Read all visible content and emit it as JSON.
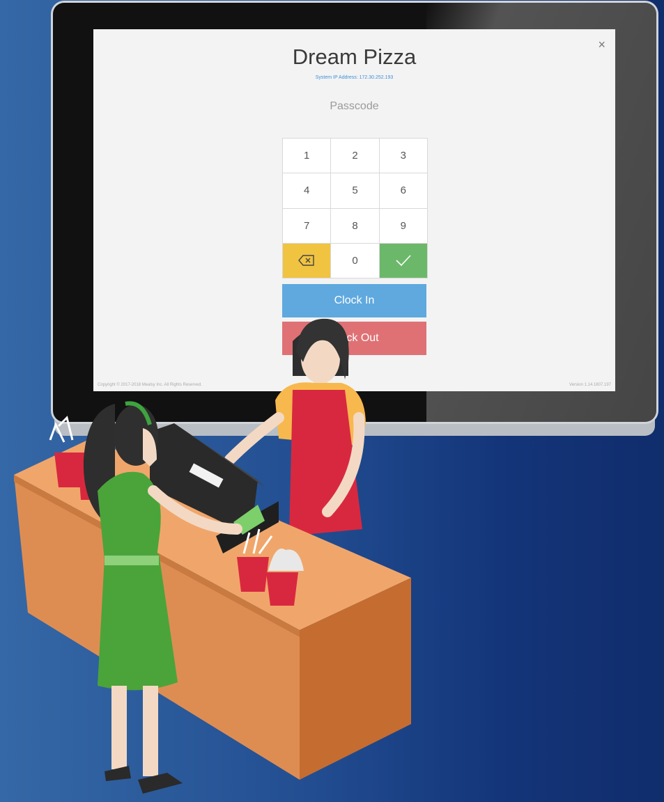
{
  "app": {
    "title": "Dream Pizza",
    "ip_line": "System IP Address: 172.30.252.193",
    "close_glyph": "×",
    "passcode_placeholder": "Passcode"
  },
  "keypad": {
    "keys": [
      "1",
      "2",
      "3",
      "4",
      "5",
      "6",
      "7",
      "8",
      "9"
    ],
    "backspace_icon": "backspace-icon",
    "zero": "0",
    "confirm_icon": "check-icon"
  },
  "actions": {
    "clock_in": "Clock In",
    "clock_out": "Clock Out"
  },
  "footer": {
    "copyright": "Copyright © 2017-2018 Mealsy Inc. All Rights Reserved.",
    "version": "Version 1.14.1807.197"
  },
  "colors": {
    "backspace": "#f0c341",
    "confirm": "#6cb86a",
    "clock_in": "#5fa9df",
    "clock_out": "#df7175",
    "ip_text": "#3f8fd8"
  }
}
